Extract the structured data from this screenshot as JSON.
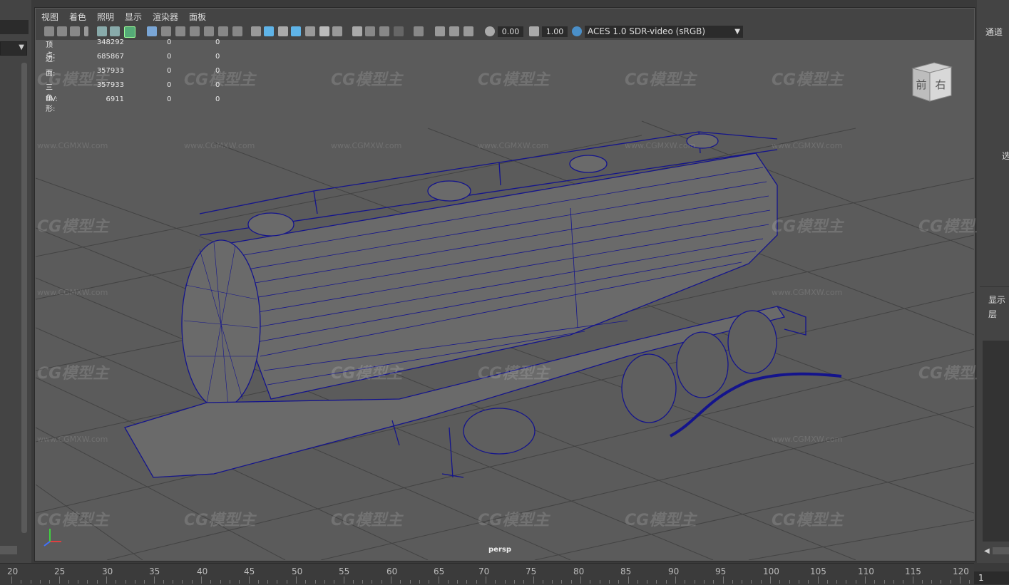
{
  "menu": {
    "items": [
      "视图",
      "着色",
      "照明",
      "显示",
      "渲染器",
      "面板"
    ]
  },
  "toolbar": {
    "exposure": "0.00",
    "gamma": "1.00",
    "color_space": "ACES 1.0 SDR-video (sRGB)"
  },
  "hud": {
    "rows": [
      {
        "label": "顶点:",
        "v1": "348292",
        "v2": "0",
        "v3": "0"
      },
      {
        "label": "边:",
        "v1": "685867",
        "v2": "0",
        "v3": "0"
      },
      {
        "label": "面:",
        "v1": "357933",
        "v2": "0",
        "v3": "0"
      },
      {
        "label": "三角形:",
        "v1": "357933",
        "v2": "0",
        "v3": "0"
      },
      {
        "label": "UV:",
        "v1": "6911",
        "v2": "0",
        "v3": "0"
      }
    ]
  },
  "viewport": {
    "camera": "persp",
    "viewcube": {
      "front": "前",
      "right": "右"
    }
  },
  "watermark": {
    "logo": "CG模型主",
    "url": "www.CGMXW.com"
  },
  "right_panel": {
    "title": "通道",
    "text_1": "选",
    "text_2": "显示",
    "text_3": "层"
  },
  "timeline": {
    "ticks": [
      "20",
      "25",
      "30",
      "35",
      "40",
      "45",
      "50",
      "55",
      "60",
      "65",
      "70",
      "75",
      "80",
      "85",
      "90",
      "95",
      "100",
      "105",
      "110",
      "115",
      "120"
    ],
    "current_frame": "1"
  },
  "colors": {
    "viewport_bg": "#5b5b5b",
    "wireframe": "#14148c",
    "ui_dark": "#444444"
  }
}
